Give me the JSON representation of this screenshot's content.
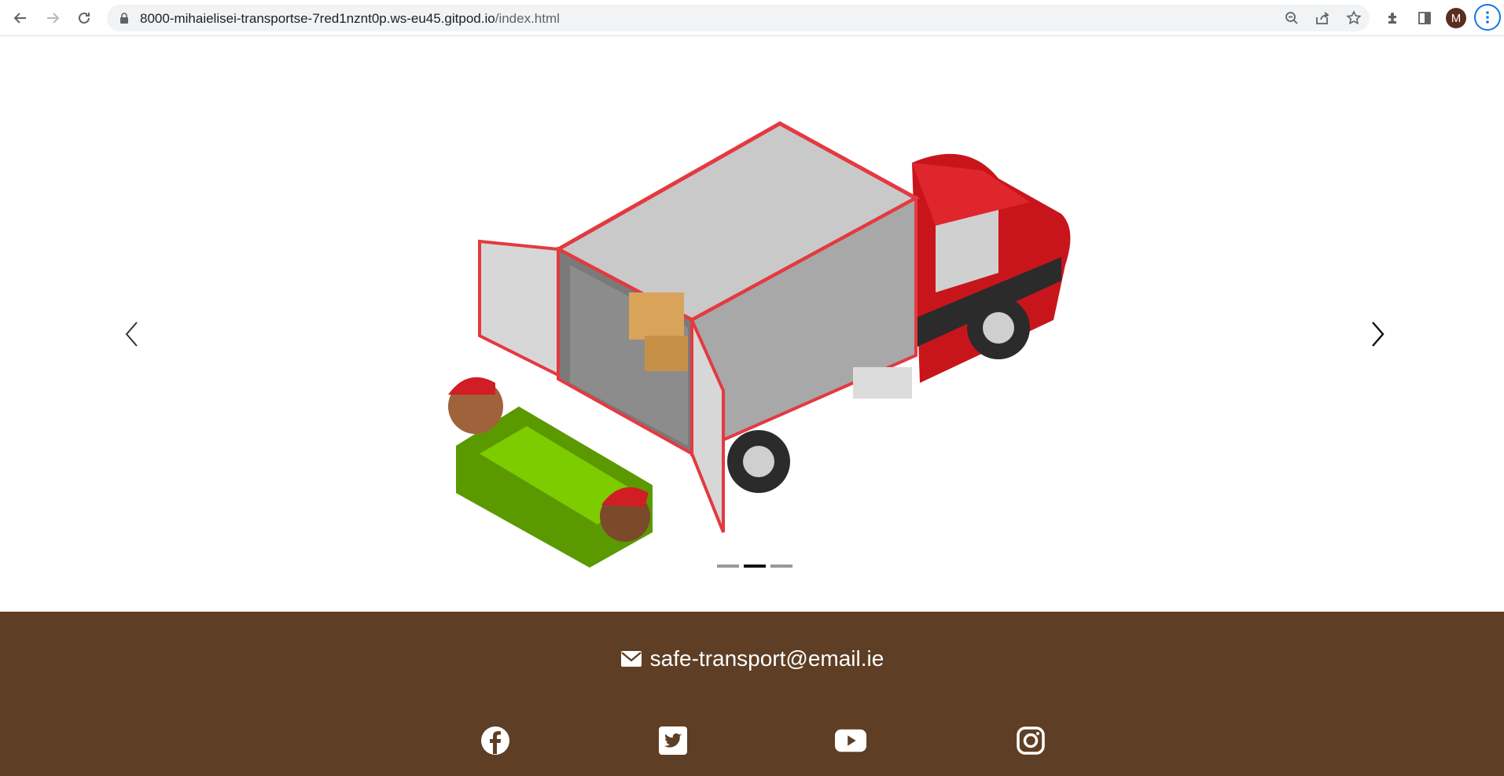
{
  "browser": {
    "url_host": "8000-mihaielisei-transportse-7red1nznt0p.ws-eu45.gitpod.io",
    "url_path": "/index.html",
    "profile_initial": "M"
  },
  "carousel": {
    "slide_count": 3,
    "active_index": 1,
    "prev_icon": "chevron-left-icon",
    "next_icon": "chevron-right-icon"
  },
  "footer": {
    "email": "safe-transport@email.ie",
    "social": [
      "facebook-icon",
      "twitter-icon",
      "youtube-icon",
      "instagram-icon"
    ],
    "background": "#5e3e24"
  }
}
